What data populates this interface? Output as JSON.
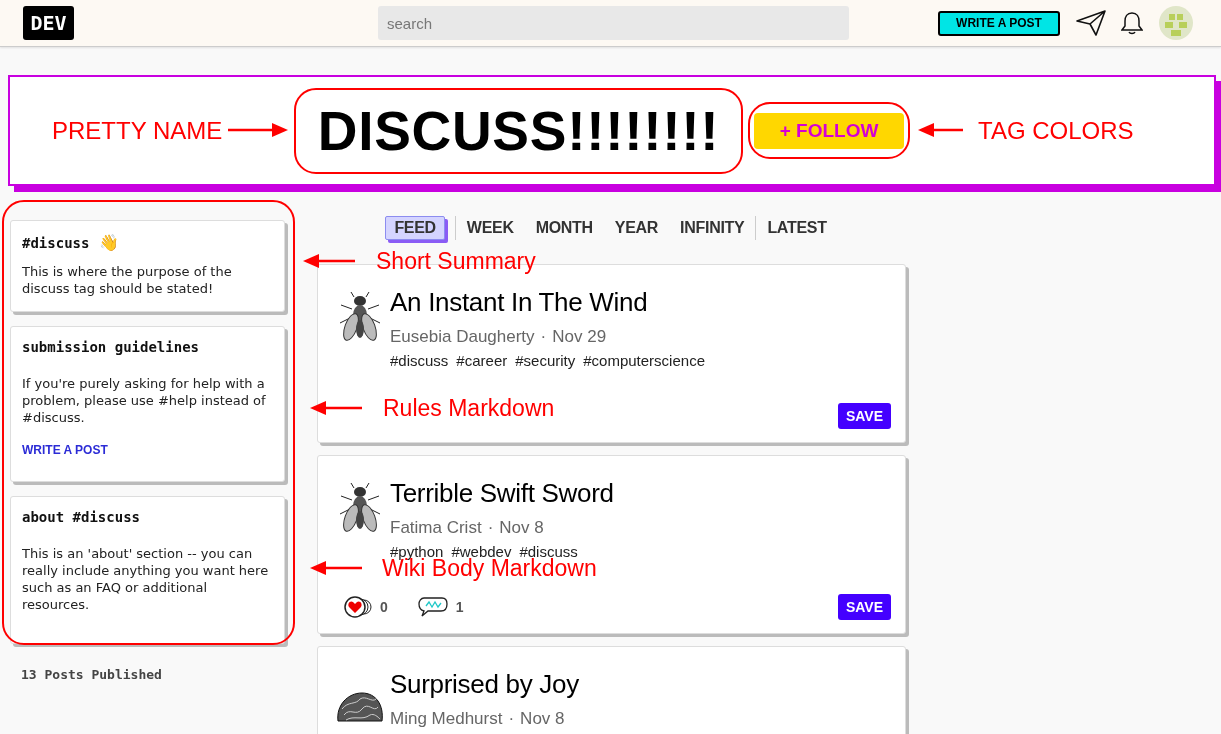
{
  "header": {
    "logo": "DEV",
    "search": {
      "placeholder": "search"
    },
    "write_button": "WRITE A POST"
  },
  "tag": {
    "name": "DISCUSS!!!!!!!!",
    "follow_button": "+ FOLLOW"
  },
  "sidebar": {
    "cards": [
      {
        "heading": "#discuss",
        "emoji": "👋",
        "body": "This is where the purpose of the discuss tag should be stated!"
      },
      {
        "heading": "submission guidelines",
        "body": "If you're purely asking for help with a problem, please use #help instead of #discuss.",
        "link": "WRITE A POST"
      },
      {
        "heading": "about #discuss",
        "body": "This is an 'about' section -- you can really include anything you want here such as an FAQ or additional resources."
      }
    ],
    "posts_count": "13 Posts Published"
  },
  "tab_groups": [
    [
      {
        "label": "FEED",
        "selected": true
      }
    ],
    [
      {
        "label": "WEEK",
        "selected": false
      },
      {
        "label": "MONTH",
        "selected": false
      },
      {
        "label": "YEAR",
        "selected": false
      },
      {
        "label": "INFINITY",
        "selected": false
      }
    ],
    [
      {
        "label": "LATEST",
        "selected": false
      }
    ]
  ],
  "posts": [
    {
      "kind": "fly",
      "title": "An Instant In The Wind",
      "author": "Eusebia Daugherty",
      "separator": "·",
      "date": "Nov 29",
      "tags": [
        "#discuss",
        "#career",
        "#security",
        "#computerscience"
      ],
      "save": "SAVE"
    },
    {
      "kind": "fly",
      "title": "Terrible Swift Sword",
      "author": "Fatima Crist",
      "separator": "·",
      "date": "Nov 8",
      "tags": [
        "#python",
        "#webdev",
        "#discuss"
      ],
      "likes": "0",
      "comments": "1",
      "save": "SAVE"
    },
    {
      "kind": "coral",
      "title": "Surprised by Joy",
      "author": "Ming Medhurst",
      "separator": "·",
      "date": "Nov 8"
    }
  ],
  "annotations": [
    {
      "text": "PRETTY NAME"
    },
    {
      "text": "TAG COLORS"
    },
    {
      "text": "Short Summary"
    },
    {
      "text": "Rules Markdown"
    },
    {
      "text": "Wiki Body Markdown"
    }
  ]
}
